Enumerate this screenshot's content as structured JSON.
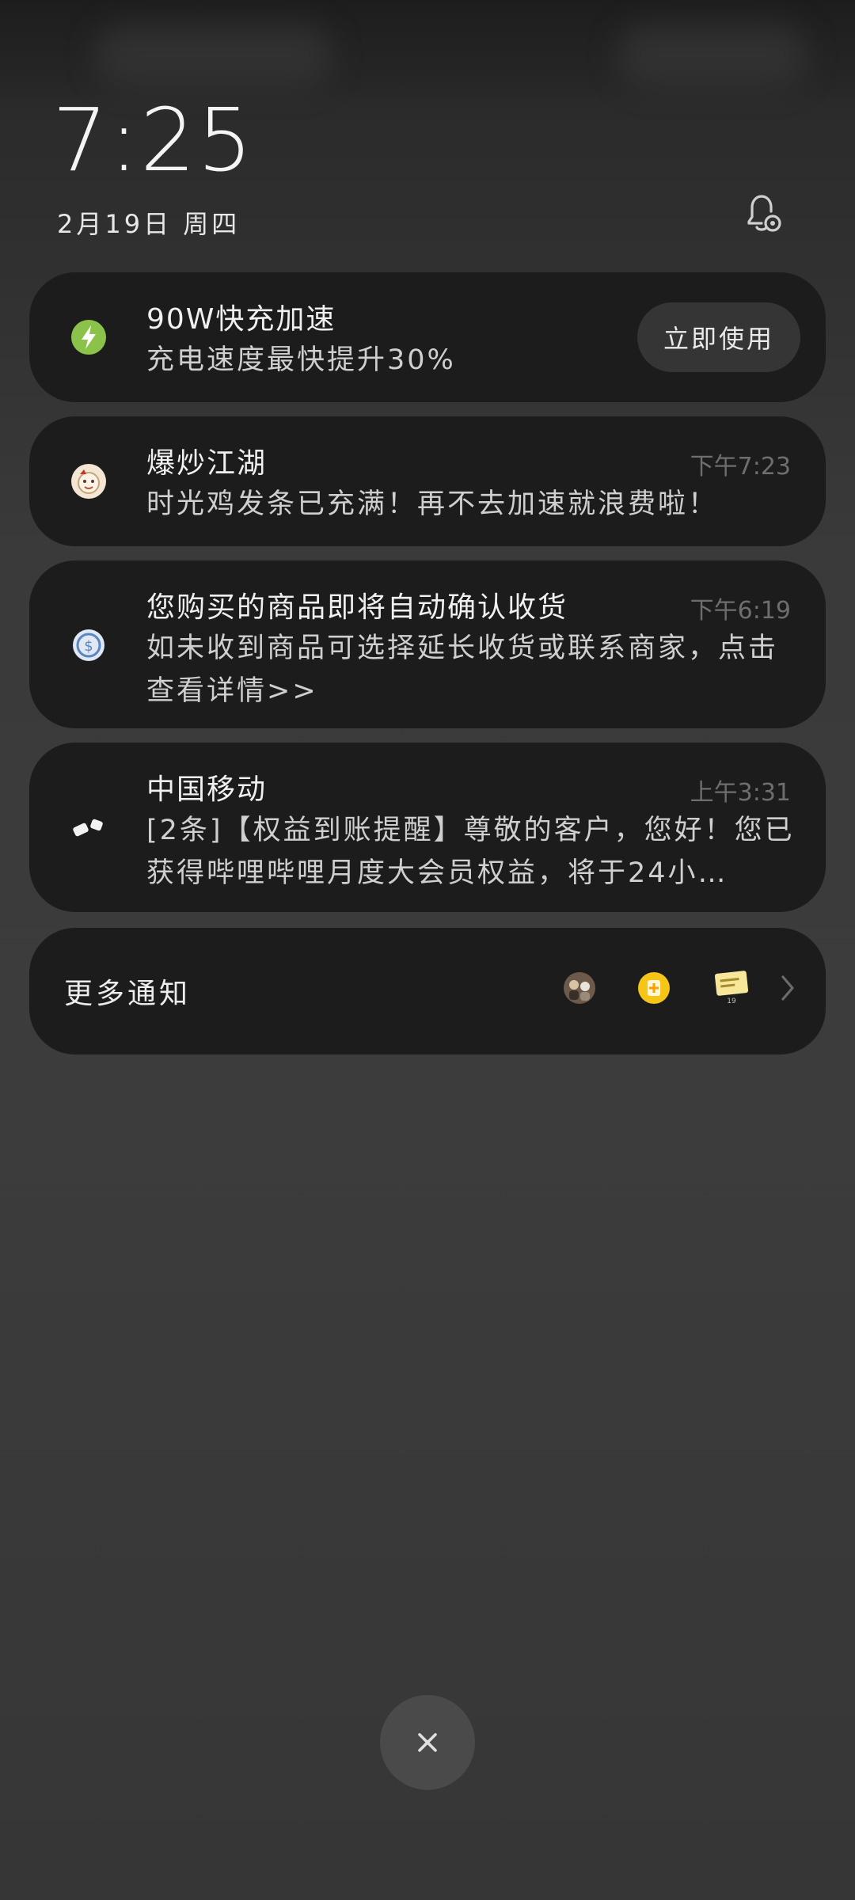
{
  "lockscreen": {
    "time": "7:25",
    "date": "2月19日 周四"
  },
  "notifications": [
    {
      "title": "90W快充加速",
      "body": "充电速度最快提升30%",
      "action_label": "立即使用",
      "icon": "lightning-icon",
      "icon_color": "#8bc34a"
    },
    {
      "title": "爆炒江湖",
      "body": "时光鸡发条已充满！再不去加速就浪费啦！",
      "time": "下午7:23",
      "icon": "game-avatar-icon"
    },
    {
      "title": "您购买的商品即将自动确认收货",
      "body": "如未收到商品可选择延长收货或联系商家，点击查看详情>>",
      "time": "下午6:19",
      "icon": "shopping-app-icon"
    },
    {
      "title": "中国移动",
      "body": "[2条]【权益到账提醒】尊敬的客户，您好！您已获得哔哩哔哩月度大会员权益，将于24小…",
      "time": "上午3:31",
      "icon": "china-mobile-icon"
    }
  ],
  "more_notifications": {
    "label": "更多通知",
    "icons": [
      "app-avatar-icon",
      "health-app-icon",
      "calendar-icon"
    ],
    "calendar_day": "19"
  },
  "controls": {
    "settings_icon": "bell-settings-icon",
    "close_icon": "close-icon",
    "chevron_icon": "chevron-right-icon"
  }
}
